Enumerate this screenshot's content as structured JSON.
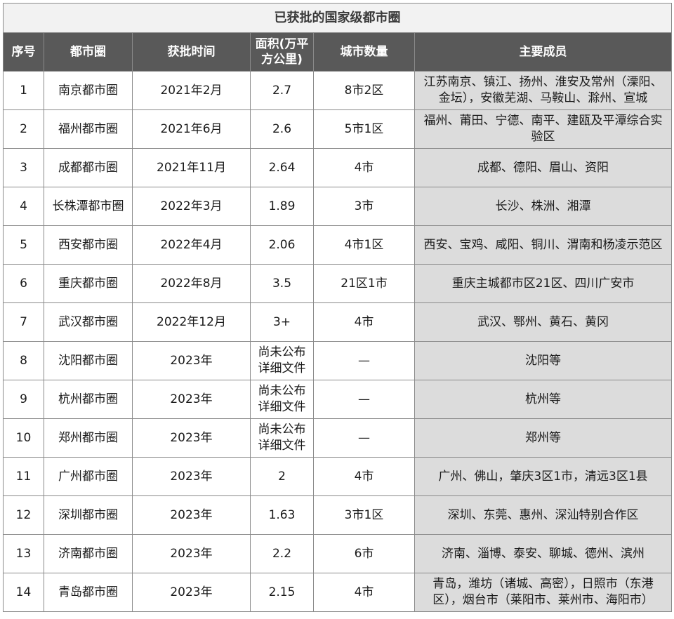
{
  "title": "已获批的国家级都市圈",
  "headers": [
    "序号",
    "都市圈",
    "获批时间",
    "面积(万平方公里)",
    "城市数量",
    "主要成员"
  ],
  "rows": [
    {
      "no": "1",
      "name": "南京都市圈",
      "date": "2021年2月",
      "area": "2.7",
      "count": "8市2区",
      "members": "江苏南京、镇江、扬州、淮安及常州（溧阳、金坛），安徽芜湖、马鞍山、滁州、宣城"
    },
    {
      "no": "2",
      "name": "福州都市圈",
      "date": "2021年6月",
      "area": "2.6",
      "count": "5市1区",
      "members": "福州、莆田、宁德、南平、建瓯及平潭综合实验区"
    },
    {
      "no": "3",
      "name": "成都都市圈",
      "date": "2021年11月",
      "area": "2.64",
      "count": "4市",
      "members": "成都、德阳、眉山、资阳"
    },
    {
      "no": "4",
      "name": "长株潭都市圈",
      "date": "2022年3月",
      "area": "1.89",
      "count": "3市",
      "members": "长沙、株洲、湘潭"
    },
    {
      "no": "5",
      "name": "西安都市圈",
      "date": "2022年4月",
      "area": "2.06",
      "count": "4市1区",
      "members": "西安、宝鸡、咸阳、铜川、渭南和杨凌示范区"
    },
    {
      "no": "6",
      "name": "重庆都市圈",
      "date": "2022年8月",
      "area": "3.5",
      "count": "21区1市",
      "members": "重庆主城都市区21区、四川广安市"
    },
    {
      "no": "7",
      "name": "武汉都市圈",
      "date": "2022年12月",
      "area": "3+",
      "count": "4市",
      "members": "武汉、鄂州、黄石、黄冈"
    },
    {
      "no": "8",
      "name": "沈阳都市圈",
      "date": "2023年",
      "area": "尚未公布详细文件",
      "count": "—",
      "members": "沈阳等"
    },
    {
      "no": "9",
      "name": "杭州都市圈",
      "date": "2023年",
      "area": "尚未公布详细文件",
      "count": "—",
      "members": "杭州等"
    },
    {
      "no": "10",
      "name": "郑州都市圈",
      "date": "2023年",
      "area": "尚未公布详细文件",
      "count": "—",
      "members": "郑州等"
    },
    {
      "no": "11",
      "name": "广州都市圈",
      "date": "2023年",
      "area": "2",
      "count": "4市",
      "members": "广州、佛山，肇庆3区1市，清远3区1县"
    },
    {
      "no": "12",
      "name": "深圳都市圈",
      "date": "2023年",
      "area": "1.63",
      "count": "3市1区",
      "members": "深圳、东莞、惠州、深汕特别合作区"
    },
    {
      "no": "13",
      "name": "济南都市圈",
      "date": "2023年",
      "area": "2.2",
      "count": "6市",
      "members": "济南、淄博、泰安、聊城、德州、滨州"
    },
    {
      "no": "14",
      "name": "青岛都市圈",
      "date": "2023年",
      "area": "2.15",
      "count": "4市",
      "members": "青岛，潍坊（诸城、高密），日照市（东港区），烟台市（莱阳市、莱州市、海阳市）"
    }
  ]
}
